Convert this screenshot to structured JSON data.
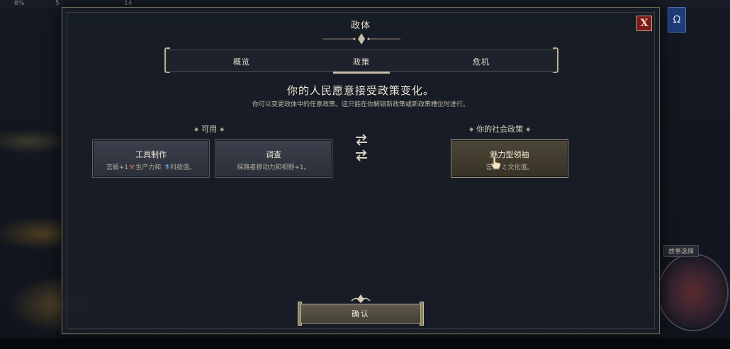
{
  "background": {
    "top_stats": [
      "8%",
      "5",
      "14"
    ],
    "corner_button_icon": "magnet-icon",
    "story_tag": "故事选择"
  },
  "dialog": {
    "title": "政体",
    "close_label": "X",
    "tabs": [
      {
        "label": "概览",
        "active": false
      },
      {
        "label": "政策",
        "active": true
      },
      {
        "label": "危机",
        "active": false
      }
    ],
    "headline": "你的人民愿意接受政策变化。",
    "subline": "你可以变更政体中的任意政策。这只能在你解锁新政策或新政策槽位时进行。",
    "available_label": "可用",
    "social_label": "你的社会政策",
    "available_policies": [
      {
        "title": "工具制作",
        "desc_a": "宫殿+1",
        "icon_a": "hammer-icon",
        "desc_b": "生产力和",
        "icon_b": "flask-icon",
        "desc_c": "科技值。"
      },
      {
        "title": "调查",
        "desc": "探路者移动力和视野+1。"
      }
    ],
    "social_policies": [
      {
        "title": "魅力型领袖",
        "desc_a": "宫殿",
        "icon_a": "music-note-icon",
        "desc_c": "文化值。"
      }
    ],
    "confirm_label": "确认",
    "colors": {
      "accent_gold": "#b2a888",
      "close_red": "#7a1a1a",
      "panel": "#181d27"
    }
  }
}
